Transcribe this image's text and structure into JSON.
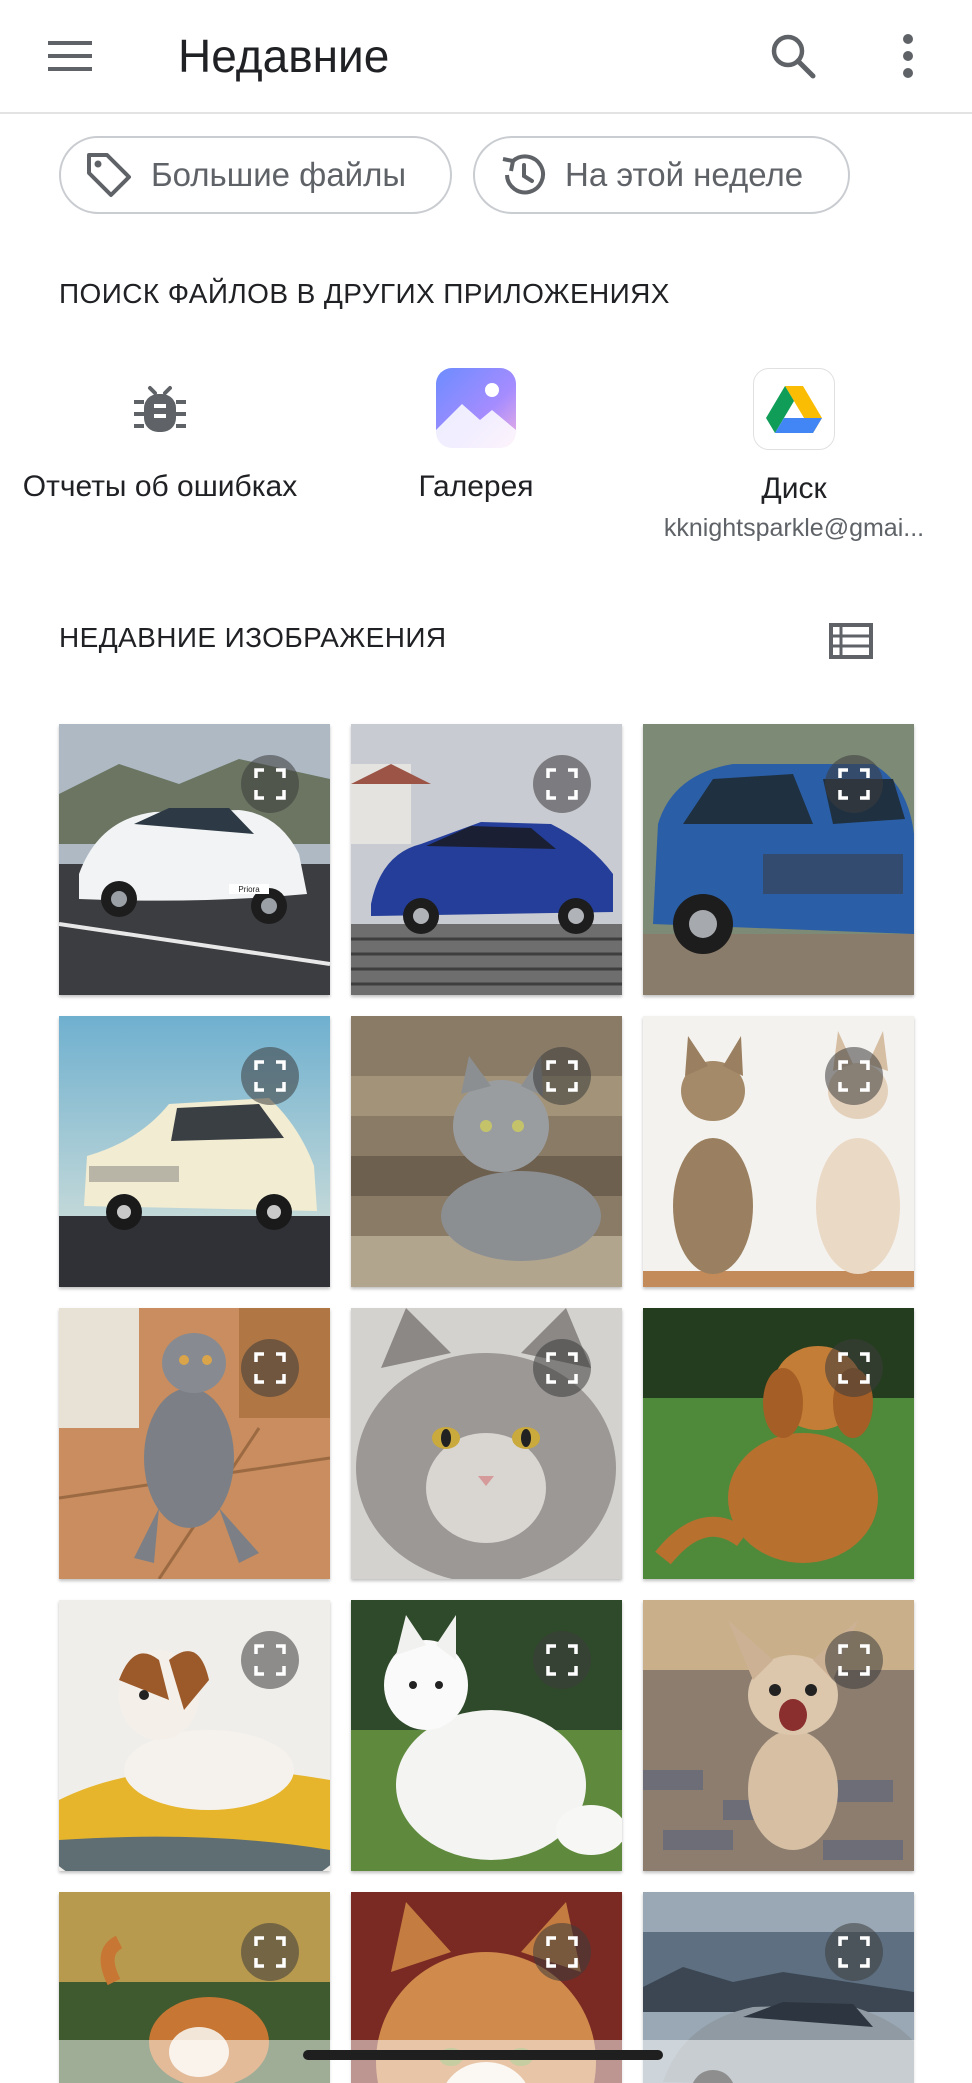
{
  "appbar": {
    "title": "Недавние",
    "menu_icon": "hamburger-menu-icon",
    "search_icon": "search-icon",
    "more_icon": "more-vert-icon"
  },
  "chips": [
    {
      "label": "Большие файлы",
      "icon": "tag-icon"
    },
    {
      "label": "На этой неделе",
      "icon": "history-icon"
    }
  ],
  "other_apps": {
    "header": "ПОИСК ФАЙЛОВ В ДРУГИХ ПРИЛОЖЕНИЯХ",
    "items": [
      {
        "label": "Отчеты об ошибках",
        "sub": "",
        "icon": "bug-icon"
      },
      {
        "label": "Галерея",
        "sub": "",
        "icon": "gallery-icon"
      },
      {
        "label": "Диск",
        "sub": "kknightsparkle@gmai...",
        "icon": "google-drive-icon"
      }
    ]
  },
  "recent_images": {
    "header": "НЕДАВНИЕ ИЗОБРАЖЕНИЯ",
    "view_toggle_icon": "list-view-icon",
    "items": [
      {
        "subject": "white-sedan",
        "plate_text": "Priora"
      },
      {
        "subject": "blue-sedan"
      },
      {
        "subject": "blue-suv"
      },
      {
        "subject": "retro-car"
      },
      {
        "subject": "grey-cat-sitting"
      },
      {
        "subject": "two-cats"
      },
      {
        "subject": "grey-cat-lounging"
      },
      {
        "subject": "fluffy-grey-cat"
      },
      {
        "subject": "golden-retriever"
      },
      {
        "subject": "jack-russell"
      },
      {
        "subject": "white-spitz"
      },
      {
        "subject": "chihuahua"
      },
      {
        "subject": "corgi"
      },
      {
        "subject": "ginger-cat"
      },
      {
        "subject": "grey-car"
      }
    ]
  },
  "colors": {
    "text_primary": "#202124",
    "text_secondary": "#5f6368",
    "chip_border": "#c9ccd0",
    "expand_badge": "#3c3c3c"
  }
}
